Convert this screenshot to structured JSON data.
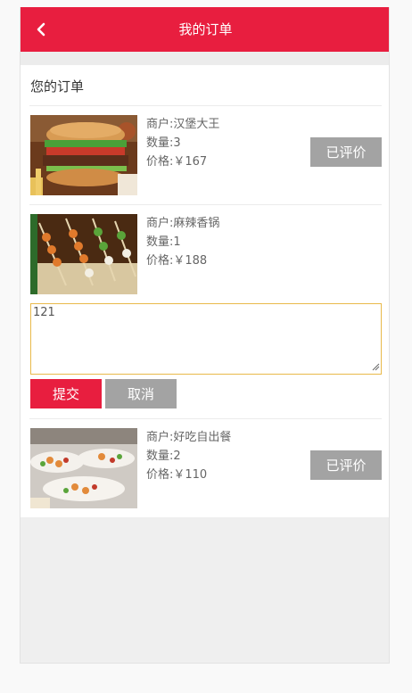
{
  "header": {
    "title": "我的订单",
    "back_icon": "chevron-left-icon"
  },
  "section_title": "您的订单",
  "orders": [
    {
      "merchant": "商户:汉堡大王",
      "quantity": "数量:3",
      "price": "价格:￥167",
      "action": "已评价",
      "image": "burger-photo"
    },
    {
      "merchant": "商户:麻辣香锅",
      "quantity": "数量:1",
      "price": "价格:￥188",
      "image": "skewers-photo"
    },
    {
      "merchant": "商户:好吃自出餐",
      "quantity": "数量:2",
      "price": "价格:￥110",
      "action": "已评价",
      "image": "buffet-photo"
    }
  ],
  "comment": {
    "value": "121"
  },
  "buttons": {
    "submit": "提交",
    "cancel": "取消"
  },
  "colors": {
    "accent": "#e81e3f",
    "rated_button": "#a3a3a3",
    "input_border": "#e9b94a"
  }
}
